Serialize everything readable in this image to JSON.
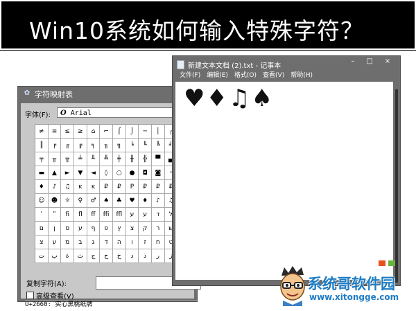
{
  "banner": {
    "title": "Win10系统如何输入特殊字符？"
  },
  "charmap": {
    "title": "字符映射表",
    "font_label": "字体(F):",
    "font_icon": "O",
    "font_name": "Arial",
    "copy_label": "复制字符(A):",
    "advanced_label": "高级查看(V)",
    "status": "U+2660: 实心黑桃纸牌",
    "grid": [
      [
        "≠",
        "≡",
        "≤",
        "≥",
        "⌂",
        "⌐",
        "⌠",
        "⌡",
        "─",
        "│",
        "┌",
        "┐"
      ],
      [
        "║",
        "╒",
        "╓",
        "╔",
        "╕",
        "╖",
        "╗",
        "╘",
        "╙",
        "╚",
        "╛",
        "╜"
      ],
      [
        "╤",
        "╥",
        "╦",
        "╧",
        "╨",
        "╩",
        "╪",
        "╫",
        "╬",
        "▀",
        "▄",
        "█"
      ],
      [
        "▬",
        "▲",
        "►",
        "▼",
        "◄",
        "◊",
        "○",
        "●",
        "◘",
        "◙",
        "◦",
        "☺"
      ],
      [
        "♦",
        "♪",
        "♫",
        "ĸ",
        "ĸ",
        "₽",
        "₽",
        "Р",
        "₽",
        "₽",
        "₽",
        "Ŧ"
      ],
      [
        "☺",
        "☻",
        "☼",
        "♀",
        "♂",
        "♠",
        "♣",
        "♥",
        "♦",
        "♪",
        "♫",
        "✝"
      ],
      [
        "ʹ",
        "ʺ",
        "ﬁ",
        "ﬂ",
        "ﬀ",
        "ﬃ",
        "ﬄ",
        "ע",
        "ע",
        "ד",
        "ל",
        "ך"
      ],
      [
        "ם",
        "ן",
        "ס",
        "ע",
        "ף",
        "פ",
        "ץ",
        "צ",
        "ק",
        "ר",
        "ש",
        "ת"
      ],
      [
        "צ",
        "ע",
        "מ",
        "ב",
        "ג",
        "ד",
        "ה",
        "ו",
        "ז",
        "ח",
        "ט",
        "י"
      ],
      [
        "ت",
        "ب",
        "ة",
        "ث",
        "ج",
        "ح",
        "خ",
        "د",
        "ذ",
        "ر",
        "ز",
        "س"
      ]
    ]
  },
  "notepad": {
    "title": "新建文本文档 (2).txt - 记事本",
    "minimize": "–",
    "maximize": "□",
    "close": "×",
    "menus": [
      "文件(F)",
      "编辑(E)",
      "格式(O)",
      "查看(V)",
      "帮助(H)"
    ],
    "content": "♥♦♫♠"
  },
  "logo": {
    "name": "系统哥软件园",
    "url": "www.xitongge.com"
  },
  "colors": {
    "banner_bg": "#000000",
    "window_frame": "#6e6e6e",
    "logo_blue": "#1e7cc4"
  }
}
